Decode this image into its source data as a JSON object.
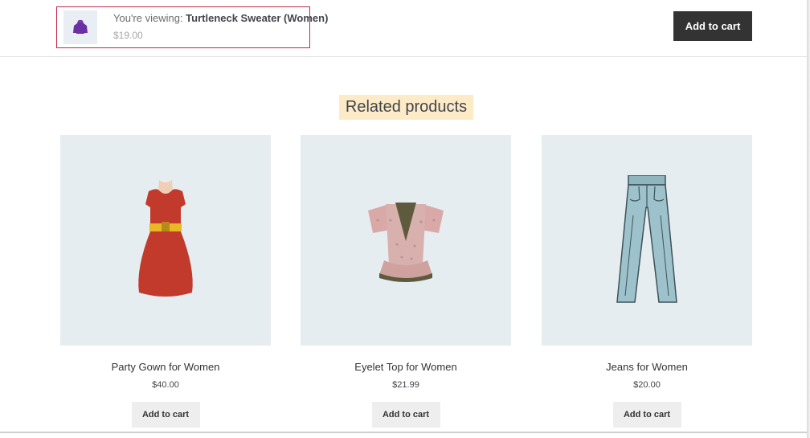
{
  "sticky_bar": {
    "viewing_prefix": "You're viewing: ",
    "product_name": "Turtleneck Sweater (Women)",
    "price": "$19.00",
    "add_to_cart_label": "Add to cart"
  },
  "related": {
    "heading": "Related products",
    "products": [
      {
        "title": "Party Gown for Women",
        "price": "$40.00",
        "button_label": "Add to cart",
        "image": "red-dress-image"
      },
      {
        "title": "Eyelet Top for Women",
        "price": "$21.99",
        "button_label": "Add to cart",
        "image": "pink-top-image"
      },
      {
        "title": "Jeans for Women",
        "price": "$20.00",
        "button_label": "Add to cart",
        "image": "blue-jeans-image"
      }
    ]
  },
  "colors": {
    "accent_border": "#c0284b",
    "dark_button": "#333333",
    "heading_highlight": "#fdebc8",
    "image_bg": "#e6edf1"
  }
}
